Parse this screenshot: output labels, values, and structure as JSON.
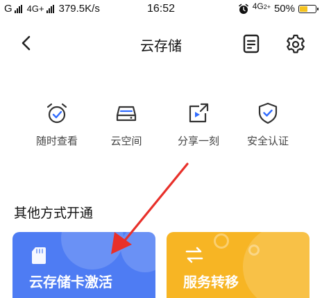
{
  "status_bar": {
    "carrier_1": "G",
    "network": "4G+",
    "speed": "379.5K/s",
    "time": "16:52",
    "network_2": "4G",
    "battery": "50%",
    "battery_level": 0.5
  },
  "nav": {
    "title": "云存储",
    "back_icon": "chevron-left-icon",
    "doc_icon": "document-icon",
    "settings_icon": "gear-icon"
  },
  "features": [
    {
      "label": "随时查看",
      "icon": "alarm-clock-icon"
    },
    {
      "label": "云空间",
      "icon": "storage-drive-icon"
    },
    {
      "label": "分享一刻",
      "icon": "share-video-icon"
    },
    {
      "label": "安全认证",
      "icon": "shield-check-icon"
    }
  ],
  "section": {
    "title": "其他方式开通"
  },
  "cards": [
    {
      "label": "云存储卡激活",
      "icon": "sd-card-icon",
      "color": "#4e7cf3"
    },
    {
      "label": "服务转移",
      "icon": "transfer-arrows-icon",
      "color": "#f7b524"
    }
  ],
  "colors": {
    "accent_icon": "#2f6bff",
    "annotation": "#e8302a"
  }
}
